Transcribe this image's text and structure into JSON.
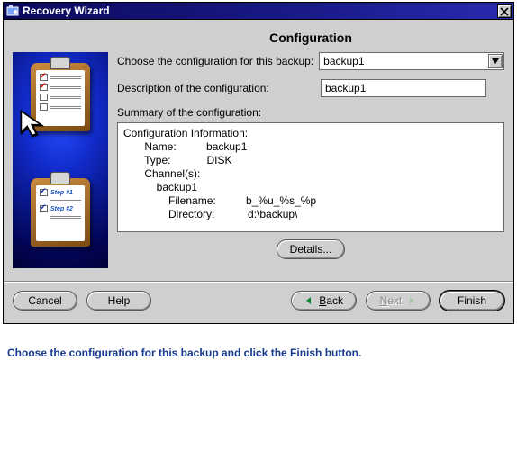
{
  "window": {
    "title": "Recovery Wizard"
  },
  "page": {
    "title": "Configuration"
  },
  "form": {
    "config_label": "Choose the configuration for this backup:",
    "config_value": "backup1",
    "desc_label": "Description of the configuration:",
    "desc_value": "backup1",
    "summary_label": "Summary of the configuration:"
  },
  "summary": {
    "heading": "Configuration Information:",
    "name_label": "Name:",
    "name_value": "backup1",
    "type_label": "Type:",
    "type_value": "DISK",
    "channels_label": "Channel(s):",
    "channel_name": "backup1",
    "filename_label": "Filename:",
    "filename_value": "b_%u_%s_%p",
    "directory_label": "Directory:",
    "directory_value": "d:\\backup\\"
  },
  "buttons": {
    "details": "Details...",
    "cancel": "Cancel",
    "help": "Help",
    "back": "Back",
    "next": "Next",
    "finish": "Finish"
  },
  "sidebar": {
    "step1": "Step #1",
    "step2": "Step #2"
  },
  "instruction": "Choose the configuration for this backup and click the Finish button."
}
